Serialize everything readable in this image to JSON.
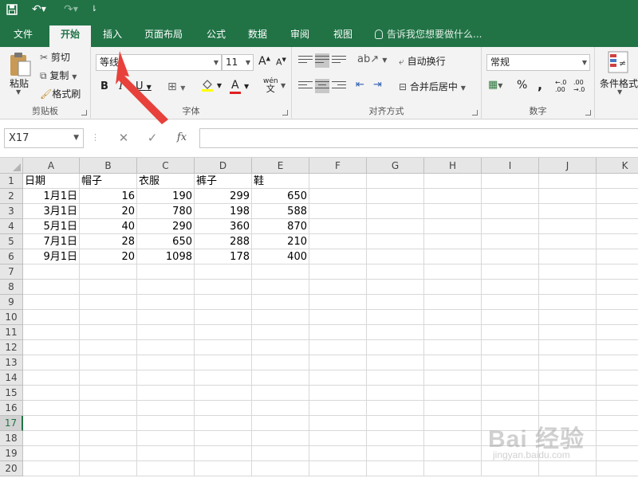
{
  "quick_access": {
    "save_icon": "save-icon",
    "undo_icon": "undo-icon",
    "redo_icon": "redo-icon",
    "customize_icon": "customize-qat-icon"
  },
  "tabs": [
    {
      "label": "文件",
      "active": false
    },
    {
      "label": "开始",
      "active": true
    },
    {
      "label": "插入",
      "active": false
    },
    {
      "label": "页面布局",
      "active": false
    },
    {
      "label": "公式",
      "active": false
    },
    {
      "label": "数据",
      "active": false
    },
    {
      "label": "审阅",
      "active": false
    },
    {
      "label": "视图",
      "active": false
    }
  ],
  "tell_me": "告诉我您想要做什么...",
  "ribbon": {
    "clipboard": {
      "paste": "粘贴",
      "cut": "剪切",
      "copy": "复制",
      "format_painter": "格式刷",
      "label": "剪贴板"
    },
    "font": {
      "font_name": "等线",
      "font_size": "11",
      "grow": "A",
      "shrink": "A",
      "bold": "B",
      "italic": "I",
      "underline": "U",
      "font_color": "A",
      "phonetic": "wén",
      "phonetic_sub": "文",
      "label": "字体"
    },
    "alignment": {
      "wrap_text": "自动换行",
      "merge_center": "合并后居中",
      "label": "对齐方式"
    },
    "number": {
      "format": "常规",
      "percent": "%",
      "comma": ",",
      "inc_decimal": "←.0 .00",
      "dec_decimal": ".00 →.0",
      "label": "数字"
    },
    "styles": {
      "conditional": "条件格式"
    }
  },
  "formula_bar": {
    "name_box": "X17",
    "cancel": "✕",
    "enter": "✓",
    "fx": "fx",
    "value": ""
  },
  "sheet": {
    "columns": [
      "A",
      "B",
      "C",
      "D",
      "E",
      "F",
      "G",
      "H",
      "I",
      "J",
      "K"
    ],
    "rows": [
      "1",
      "2",
      "3",
      "4",
      "5",
      "6",
      "7",
      "8",
      "9",
      "10",
      "11",
      "12",
      "13",
      "14",
      "15",
      "16",
      "17",
      "18",
      "19",
      "20"
    ],
    "active_row": "17",
    "header": [
      "日期",
      "帽子",
      "衣服",
      "裤子",
      "鞋"
    ],
    "data": [
      [
        "1月1日",
        "16",
        "190",
        "299",
        "650"
      ],
      [
        "3月1日",
        "20",
        "780",
        "198",
        "588"
      ],
      [
        "5月1日",
        "40",
        "290",
        "360",
        "870"
      ],
      [
        "7月1日",
        "28",
        "650",
        "288",
        "210"
      ],
      [
        "9月1日",
        "20",
        "1098",
        "178",
        "400"
      ]
    ]
  },
  "colors": {
    "brand_green": "#217346",
    "arrow_red": "#e8403a"
  },
  "watermark": {
    "big": "Bai 经验",
    "small": "jingyan.baidu.com"
  }
}
